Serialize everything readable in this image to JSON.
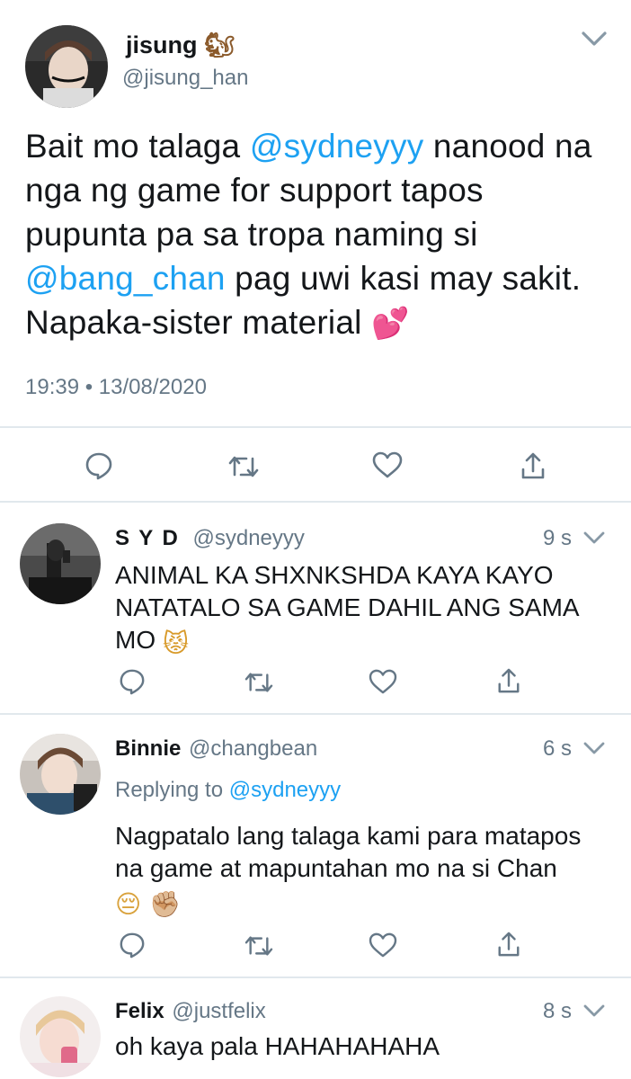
{
  "main_tweet": {
    "name": "jisung",
    "name_emoji": "🐿",
    "handle": "@jisung_han",
    "text_parts": [
      "Bait mo talaga ",
      "@sydneyyy",
      " nanood na nga ng game for support tapos pupunta pa sa tropa naming si ",
      "@bang_chan",
      " pag uwi kasi may sakit. Napaka-sister material "
    ],
    "text_emoji": "💕",
    "timestamp": "19:39 • 13/08/2020"
  },
  "replies": [
    {
      "name": "S Y D",
      "handle": "@sydneyyy",
      "time": "9 s",
      "replying_to_label": "",
      "replying_to_handle": "",
      "text": "ANIMAL KA SHXNKSHDA KAYA KAYO NATATALO SA GAME DAHIL ANG SAMA MO",
      "emoji": "😾"
    },
    {
      "name": "Binnie",
      "handle": "@changbean",
      "time": "6 s",
      "replying_to_label": "Replying to",
      "replying_to_handle": "@sydneyyy",
      "text": "Nagpatalo lang talaga kami para matapos na game at mapuntahan mo na si Chan",
      "emoji": "😔 ✊🏼"
    },
    {
      "name": "Felix",
      "handle": "@justfelix",
      "time": "8 s",
      "replying_to_label": "",
      "replying_to_handle": "",
      "text": "oh kaya pala HAHAHAHAHA",
      "emoji": ""
    }
  ],
  "icons": {
    "reply": "reply-icon",
    "retweet": "retweet-icon",
    "like": "like-icon",
    "share": "share-icon",
    "chevron": "chevron-down-icon"
  },
  "colors": {
    "link": "#1da1f2",
    "muted": "#657786",
    "icon": "#657786",
    "divider": "#e1e8ed"
  }
}
